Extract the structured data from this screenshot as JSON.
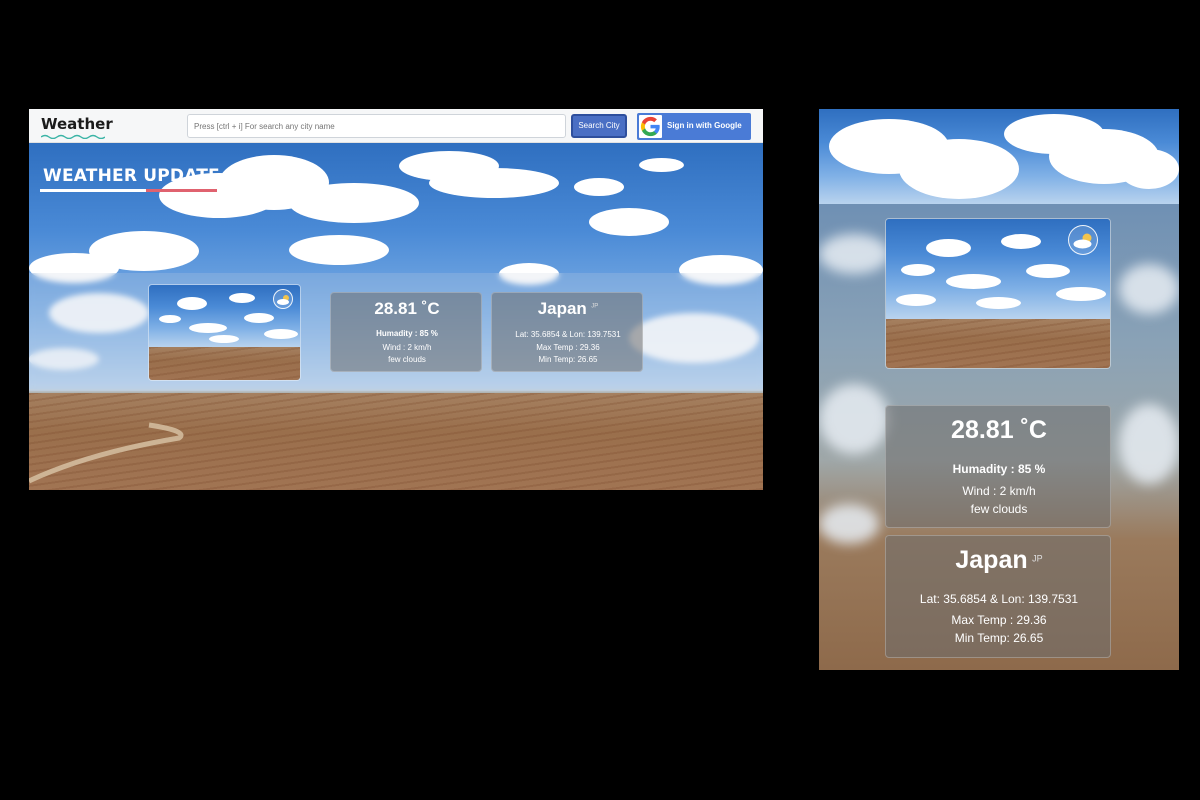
{
  "navbar": {
    "brand": "Weather",
    "search_placeholder": "Press [ctrl + i] For search any city name",
    "search_button": "Search City",
    "google_button": "Sign in with Google"
  },
  "hero": {
    "title": "WEATHER UPDATE"
  },
  "weather": {
    "temperature": "28.81",
    "temp_unit": "˚C",
    "humidity": "Humadity : 85 %",
    "wind": "Wind : 2 km/h",
    "description": "few clouds",
    "icon": "few-clouds-icon"
  },
  "location": {
    "country": "Japan",
    "country_code": "JP",
    "coords": "Lat: 35.6854 & Lon: 139.7531",
    "max_temp": "Max Temp : 29.36",
    "min_temp": "Min Temp: 26.65"
  },
  "colors": {
    "accent": "#e0626f",
    "primary_button": "#4a6fc4",
    "google_button": "#4a7bd6"
  }
}
